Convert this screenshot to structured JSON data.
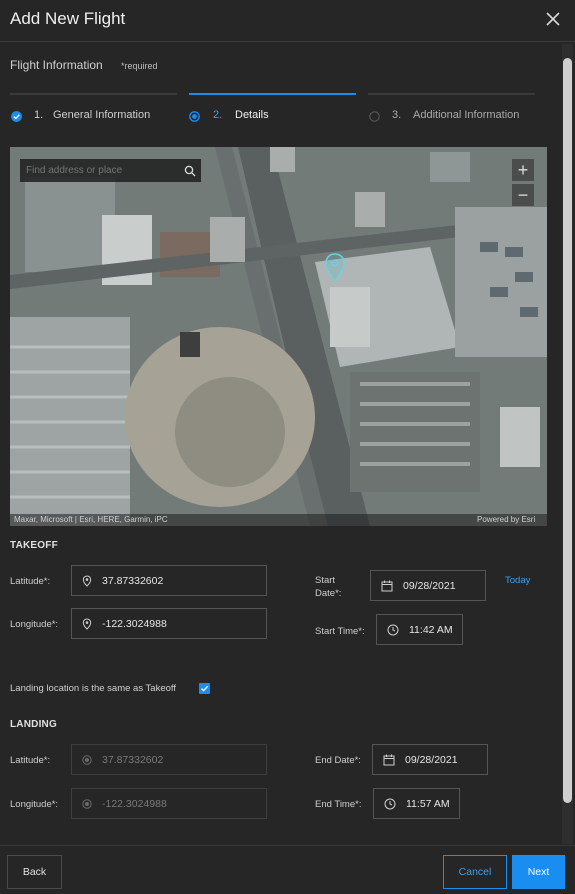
{
  "header": {
    "title": "Add New Flight"
  },
  "form": {
    "section_title": "Flight Information",
    "required_note": "*required"
  },
  "steps": [
    {
      "num": "1.",
      "label": "General Information",
      "state": "complete"
    },
    {
      "num": "2.",
      "label": "Details",
      "state": "active"
    },
    {
      "num": "3.",
      "label": "Additional Information",
      "state": "pending"
    }
  ],
  "map": {
    "search_placeholder": "Find address or place",
    "zoom_in": "+",
    "zoom_out": "−",
    "attribution": "Maxar, Microsoft | Esri, HERE, Garmin, iPC",
    "powered_by": "Powered by Esri"
  },
  "takeoff": {
    "heading": "TAKEOFF",
    "latitude_label": "Latitude*:",
    "latitude": "37.87332602",
    "longitude_label": "Longitude*:",
    "longitude": "-122.3024988",
    "start_date_label_1": "Start",
    "start_date_label_2": "Date*:",
    "start_date": "09/28/2021",
    "today_link": "Today",
    "start_time_label": "Start Time*:",
    "start_time": "11:42  AM"
  },
  "landing_same": {
    "label": "Landing location is the same as Takeoff",
    "checked": true
  },
  "landing": {
    "heading": "LANDING",
    "latitude_label": "Latitude*:",
    "latitude": "37.87332602",
    "longitude_label": "Longitude*:",
    "longitude": "-122.3024988",
    "end_date_label": "End Date*:",
    "end_date": "09/28/2021",
    "end_time_label": "End Time*:",
    "end_time": "11:57  AM"
  },
  "footer": {
    "back": "Back",
    "cancel": "Cancel",
    "next": "Next"
  },
  "colors": {
    "accent": "#1a8ef0",
    "background": "#262626"
  }
}
